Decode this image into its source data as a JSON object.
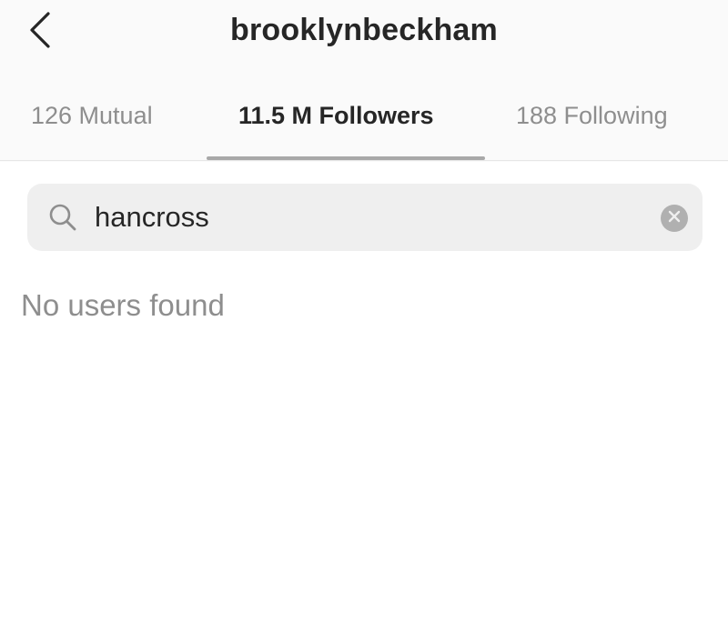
{
  "header": {
    "title": "brooklynbeckham",
    "back_icon": "chevron-left-icon"
  },
  "tabs": [
    {
      "label": "126 Mutual",
      "active": false
    },
    {
      "label": "11.5 M Followers",
      "active": true
    },
    {
      "label": "188 Following",
      "active": false
    }
  ],
  "search": {
    "value": "hancross",
    "icon": "search-icon",
    "clear_icon": "clear-icon"
  },
  "results": {
    "empty_message": "No users found"
  },
  "colors": {
    "text_primary": "#262626",
    "text_secondary": "#8e8e8e",
    "search_bg": "#efefef",
    "header_bg": "#fafafa"
  }
}
